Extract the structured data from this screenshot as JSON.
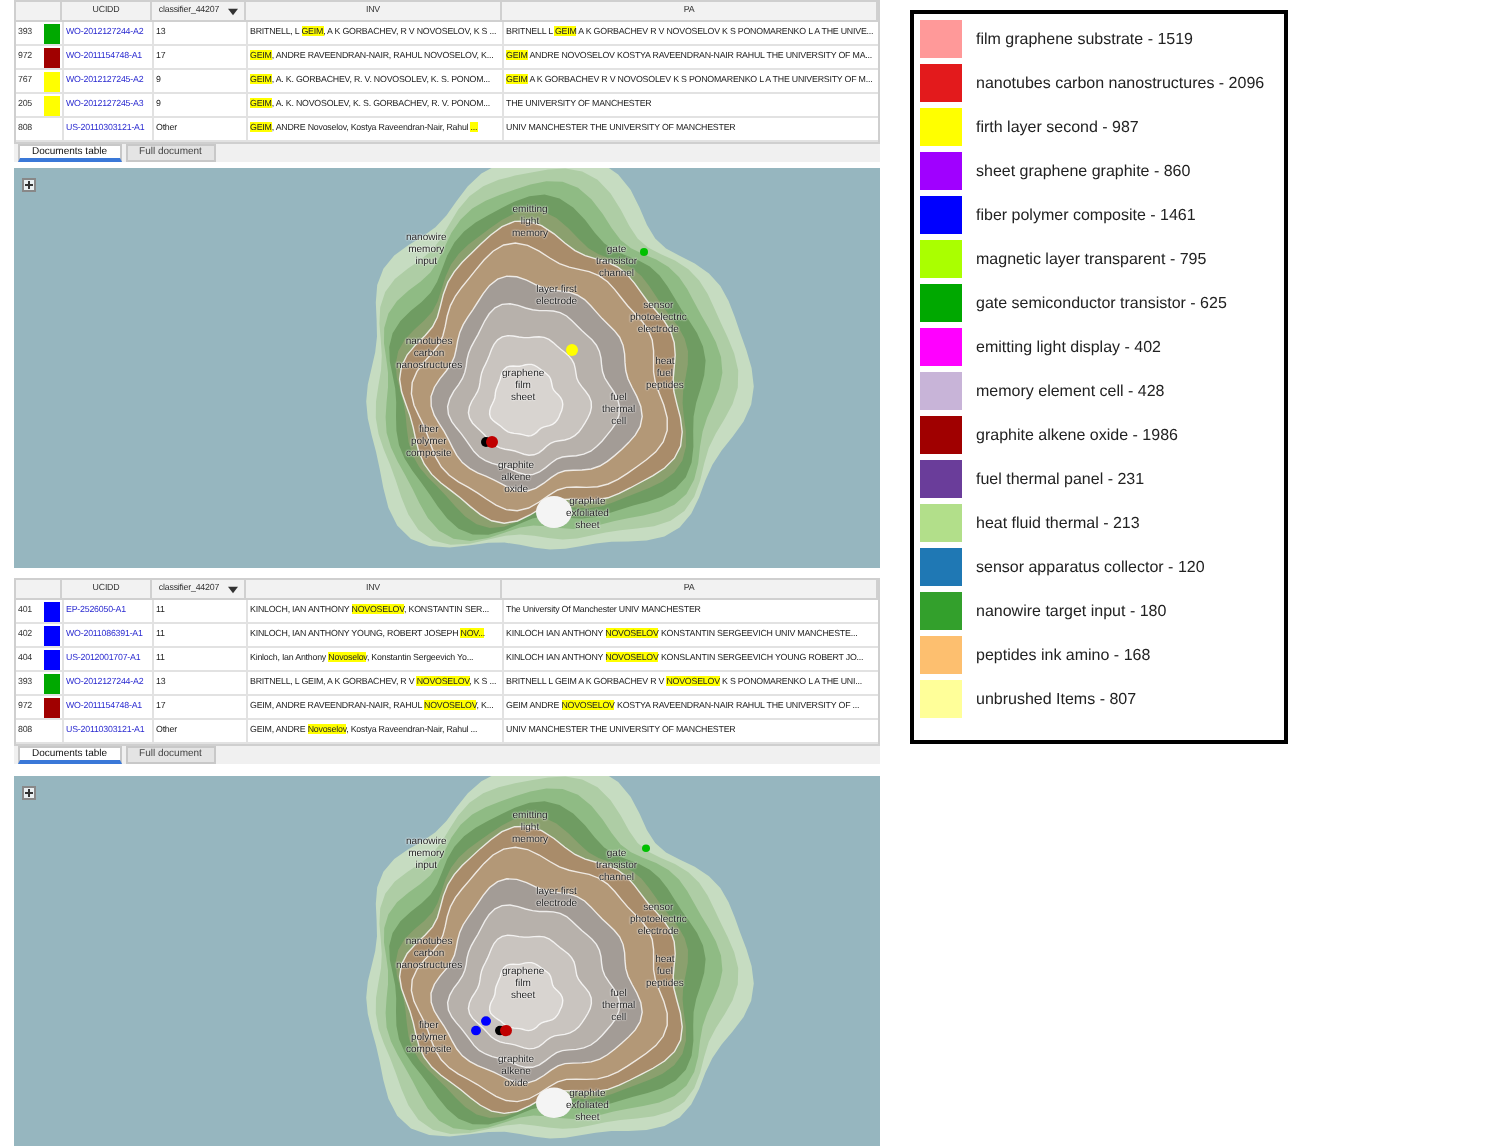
{
  "panels": [
    {
      "table": {
        "columns": [
          "UCIDD",
          "classifier_44207",
          "INV",
          "PA"
        ],
        "rows": [
          {
            "row_number": "393",
            "color": "#00a800",
            "ucidd": "WO-2012127244-A2",
            "classifier": "13",
            "inv": [
              {
                "text": "BRITNELL, L ",
                "highlight": false
              },
              {
                "text": "GEIM",
                "highlight": true
              },
              {
                "text": ", A K GORBACHEV, R V NOVOSELOV, K S ...",
                "highlight": false
              }
            ],
            "pa": [
              {
                "text": "BRITNELL L ",
                "highlight": false
              },
              {
                "text": "GEIM",
                "highlight": true
              },
              {
                "text": " A K GORBACHEV R V NOVOSELOV K S PONOMARENKO L A THE UNIVE...",
                "highlight": false
              }
            ]
          },
          {
            "row_number": "972",
            "color": "#a00000",
            "ucidd": "WO-2011154748-A1",
            "classifier": "17",
            "inv": [
              {
                "text": "GEIM",
                "highlight": true
              },
              {
                "text": ", ANDRE RAVEENDRAN-NAIR, RAHUL NOVOSELOV, K...",
                "highlight": false
              }
            ],
            "pa": [
              {
                "text": "GEIM",
                "highlight": true
              },
              {
                "text": " ANDRE NOVOSELOV KOSTYA RAVEENDRAN-NAIR RAHUL THE UNIVERSITY OF MA...",
                "highlight": false
              }
            ]
          },
          {
            "row_number": "767",
            "color": "#ffff00",
            "ucidd": "WO-2012127245-A2",
            "classifier": "9",
            "inv": [
              {
                "text": "GEIM",
                "highlight": true
              },
              {
                "text": ", A. K. GORBACHEV, R. V. NOVOSOLEV, K. S. PONOM...",
                "highlight": false
              }
            ],
            "pa": [
              {
                "text": "GEIM",
                "highlight": true
              },
              {
                "text": " A K GORBACHEV R V NOVOSOLEV K S PONOMARENKO L A THE UNIVERSITY OF M...",
                "highlight": false
              }
            ]
          },
          {
            "row_number": "205",
            "color": "#ffff00",
            "ucidd": "WO-2012127245-A3",
            "classifier": "9",
            "inv": [
              {
                "text": "GEIM",
                "highlight": true
              },
              {
                "text": ", A. K. NOVOSOLEV, K. S. GORBACHEV, R. V. PONOM...",
                "highlight": false
              }
            ],
            "pa": [
              {
                "text": "THE UNIVERSITY OF MANCHESTER",
                "highlight": false
              }
            ]
          },
          {
            "row_number": "808",
            "ucidd": "US-20110303121-A1",
            "classifier": "Other",
            "inv": [
              {
                "text": "GEIM",
                "highlight": true
              },
              {
                "text": ", ANDRE Novoselov, Kostya Raveendran-Nair, Rahul ",
                "highlight": false
              },
              {
                "text": "...",
                "highlight": true
              }
            ],
            "pa": [
              {
                "text": "UNIV MANCHESTER THE UNIVERSITY OF MANCHESTER",
                "highlight": false
              }
            ]
          }
        ]
      },
      "tabs": [
        {
          "label": "Documents table",
          "selected": true
        },
        {
          "label": "Full document",
          "selected": false
        }
      ],
      "map": {
        "labels": [
          "emitting light memory",
          "nanowire memory input",
          "gate transistor channel",
          "layer first electrode",
          "sensor photoelectric electrode",
          "nanotubes carbon nanostructures",
          "heat fuel peptides",
          "graphene film sheet",
          "fuel thermal cell",
          "fiber polymer composite",
          "graphite alkene oxide",
          "graphite exfoliated sheet"
        ]
      }
    },
    {
      "table": {
        "columns": [
          "UCIDD",
          "classifier_44207",
          "INV",
          "PA"
        ],
        "rows": [
          {
            "row_number": "401",
            "color": "#0000ff",
            "ucidd": "EP-2526050-A1",
            "classifier": "11",
            "inv": [
              {
                "text": "KINLOCH, IAN ANTHONY ",
                "highlight": false
              },
              {
                "text": "NOVOSELOV",
                "highlight": true
              },
              {
                "text": ", KONSTANTIN SER...",
                "highlight": false
              }
            ],
            "pa": [
              {
                "text": "The University Of Manchester UNIV MANCHESTER",
                "highlight": false
              }
            ]
          },
          {
            "row_number": "402",
            "color": "#0000ff",
            "ucidd": "WO-2011086391-A1",
            "classifier": "11",
            "inv": [
              {
                "text": "KINLOCH, IAN ANTHONY YOUNG, ROBERT JOSEPH ",
                "highlight": false
              },
              {
                "text": "NOV...",
                "highlight": true
              }
            ],
            "pa": [
              {
                "text": "KINLOCH IAN ANTHONY ",
                "highlight": false
              },
              {
                "text": "NOVOSELOV",
                "highlight": true
              },
              {
                "text": " KONSTANTIN SERGEEVICH UNIV MANCHESTE...",
                "highlight": false
              }
            ]
          },
          {
            "row_number": "404",
            "color": "#0000ff",
            "ucidd": "US-2012001707-A1",
            "classifier": "11",
            "inv": [
              {
                "text": "Kinloch, Ian Anthony ",
                "highlight": false
              },
              {
                "text": "Novoselov",
                "highlight": true
              },
              {
                "text": ", Konstantin Sergeevich Yo...",
                "highlight": false
              }
            ],
            "pa": [
              {
                "text": "KINLOCH IAN ANTHONY ",
                "highlight": false
              },
              {
                "text": "NOVOSELOV",
                "highlight": true
              },
              {
                "text": " KONSLANTIN SERGEEVICH YOUNG ROBERT JO...",
                "highlight": false
              }
            ]
          },
          {
            "row_number": "393",
            "color": "#00a800",
            "ucidd": "WO-2012127244-A2",
            "classifier": "13",
            "inv": [
              {
                "text": "BRITNELL, L GEIM, A K GORBACHEV, R V ",
                "highlight": false
              },
              {
                "text": "NOVOSELOV",
                "highlight": true
              },
              {
                "text": ", K S ...",
                "highlight": false
              }
            ],
            "pa": [
              {
                "text": "BRITNELL L GEIM A K GORBACHEV R V ",
                "highlight": false
              },
              {
                "text": "NOVOSELOV",
                "highlight": true
              },
              {
                "text": " K S PONOMARENKO L A THE UNI...",
                "highlight": false
              }
            ]
          },
          {
            "row_number": "972",
            "color": "#a00000",
            "ucidd": "WO-2011154748-A1",
            "classifier": "17",
            "inv": [
              {
                "text": "GEIM, ANDRE RAVEENDRAN-NAIR, RAHUL ",
                "highlight": false
              },
              {
                "text": "NOVOSELOV",
                "highlight": true
              },
              {
                "text": ", K...",
                "highlight": false
              }
            ],
            "pa": [
              {
                "text": "GEIM ANDRE ",
                "highlight": false
              },
              {
                "text": "NOVOSELOV",
                "highlight": true
              },
              {
                "text": " KOSTYA RAVEENDRAN-NAIR RAHUL THE UNIVERSITY OF ...",
                "highlight": false
              }
            ]
          },
          {
            "row_number": "808",
            "ucidd": "US-20110303121-A1",
            "classifier": "Other",
            "inv": [
              {
                "text": "GEIM, ANDRE ",
                "highlight": false
              },
              {
                "text": "Novoselov",
                "highlight": true
              },
              {
                "text": ", Kostya Raveendran-Nair, Rahul ...",
                "highlight": false
              }
            ],
            "pa": [
              {
                "text": "UNIV MANCHESTER THE UNIVERSITY OF MANCHESTER",
                "highlight": false
              }
            ]
          }
        ]
      },
      "tabs": [
        {
          "label": "Documents table",
          "selected": true
        },
        {
          "label": "Full document",
          "selected": false
        }
      ],
      "map": {
        "labels": [
          "emitting light memory",
          "nanowire memory input",
          "gate transistor channel",
          "layer first electrode",
          "sensor photoelectric electrode",
          "nanotubes carbon nanostructures",
          "heat fuel peptides",
          "graphene film sheet",
          "fuel thermal cell",
          "fiber polymer composite",
          "graphite alkene oxide",
          "graphite exfoliated sheet"
        ]
      }
    }
  ],
  "legend": [
    {
      "color": "#ff9999",
      "label": "film graphene substrate - 1519"
    },
    {
      "color": "#e31a1c",
      "label": "nanotubes carbon nanostructures - 2096"
    },
    {
      "color": "#ffff00",
      "label": "firth layer second - 987"
    },
    {
      "color": "#a000ff",
      "label": "sheet graphene graphite - 860"
    },
    {
      "color": "#0000ff",
      "label": "fiber polymer composite - 1461"
    },
    {
      "color": "#aaff00",
      "label": "magnetic layer transparent - 795"
    },
    {
      "color": "#00a800",
      "label": "gate semiconductor transistor - 625"
    },
    {
      "color": "#ff00ff",
      "label": "emitting light display - 402"
    },
    {
      "color": "#c8b4d8",
      "label": "memory element cell - 428"
    },
    {
      "color": "#a00000",
      "label": "graphite alkene oxide - 1986"
    },
    {
      "color": "#6a3d9a",
      "label": "fuel thermal panel - 231"
    },
    {
      "color": "#b2df8a",
      "label": "heat fluid thermal - 213"
    },
    {
      "color": "#1f78b4",
      "label": "sensor apparatus collector - 120"
    },
    {
      "color": "#33a02c",
      "label": "nanowire target input - 180"
    },
    {
      "color": "#fdbf6f",
      "label": "peptides ink amino - 168"
    },
    {
      "color": "#ffff99",
      "label": "unbrushed Items - 807"
    }
  ]
}
